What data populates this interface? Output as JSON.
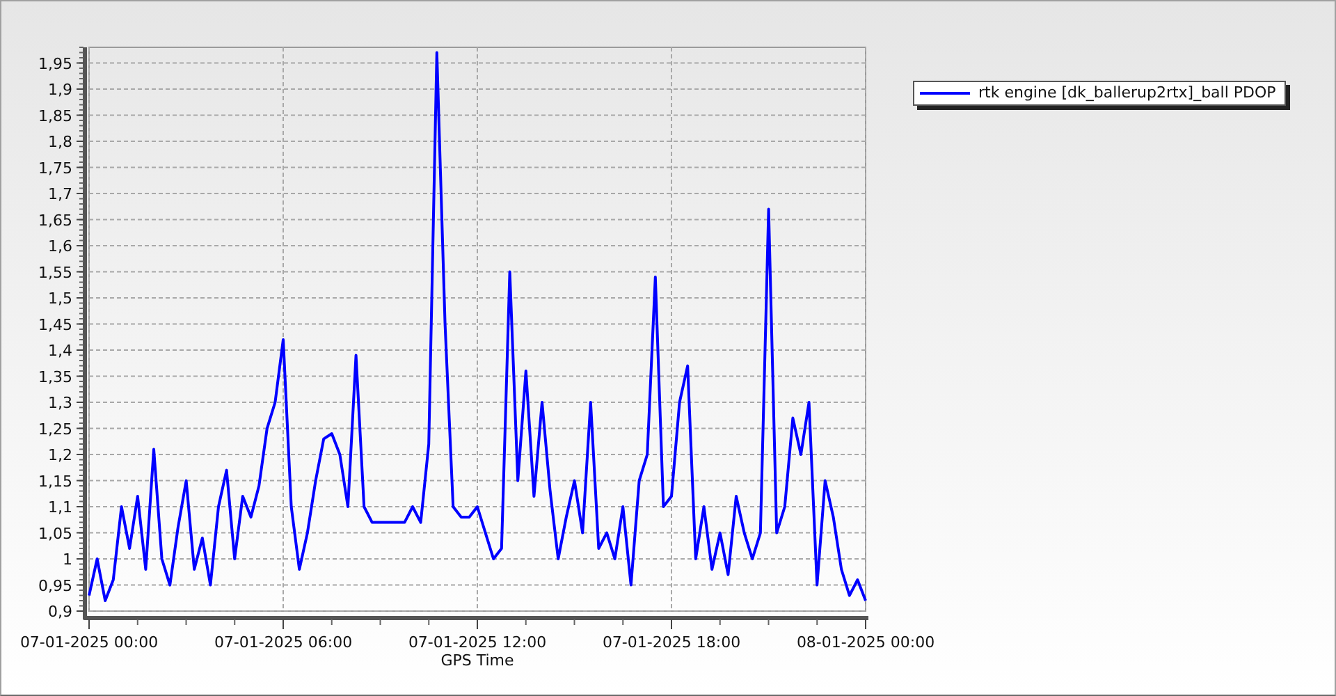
{
  "chart": {
    "chart_data": {
      "type": "line",
      "xlabel": "GPS Time",
      "categories": [
        "07-01-2025 00:00",
        null,
        null,
        null,
        null,
        null,
        null,
        null,
        null,
        null,
        null,
        null,
        null,
        null,
        null,
        null,
        null,
        null,
        null,
        null,
        null,
        null,
        null,
        null,
        "07-01-2025 06:00",
        null,
        null,
        null,
        null,
        null,
        null,
        null,
        null,
        null,
        null,
        null,
        null,
        null,
        null,
        null,
        null,
        null,
        null,
        null,
        null,
        null,
        null,
        null,
        "07-01-2025 12:00",
        null,
        null,
        null,
        null,
        null,
        null,
        null,
        null,
        null,
        null,
        null,
        null,
        null,
        null,
        null,
        null,
        null,
        null,
        null,
        null,
        null,
        null,
        null,
        "07-01-2025 18:00",
        null,
        null,
        null,
        null,
        null,
        null,
        null,
        null,
        null,
        null,
        null,
        null,
        null,
        null,
        null,
        null,
        null,
        null,
        null,
        null,
        null,
        null,
        null,
        "08-01-2025 00:00"
      ],
      "series": [
        {
          "name": "rtk engine [dk_ballerup2rtx]_ball PDOP",
          "color": "#0000ff",
          "values": [
            0.93,
            1.0,
            0.92,
            0.96,
            1.1,
            1.02,
            1.12,
            0.98,
            1.21,
            1.0,
            0.95,
            1.06,
            1.15,
            0.98,
            1.04,
            0.95,
            1.1,
            1.17,
            1.0,
            1.12,
            1.08,
            1.14,
            1.25,
            1.3,
            1.42,
            1.1,
            0.98,
            1.05,
            1.15,
            1.23,
            1.24,
            1.2,
            1.1,
            1.39,
            1.1,
            1.07,
            1.07,
            1.07,
            1.07,
            1.07,
            1.1,
            1.07,
            1.22,
            1.97,
            1.45,
            1.1,
            1.08,
            1.08,
            1.1,
            1.05,
            1.0,
            1.02,
            1.55,
            1.15,
            1.36,
            1.12,
            1.3,
            1.13,
            1.0,
            1.08,
            1.15,
            1.05,
            1.3,
            1.02,
            1.05,
            1.0,
            1.1,
            0.95,
            1.15,
            1.2,
            1.54,
            1.1,
            1.12,
            1.3,
            1.37,
            1.0,
            1.1,
            0.98,
            1.05,
            0.97,
            1.12,
            1.05,
            1.0,
            1.05,
            1.67,
            1.05,
            1.1,
            1.27,
            1.2,
            1.3,
            0.95,
            1.15,
            1.08,
            0.98,
            0.93,
            0.96,
            0.92
          ]
        }
      ],
      "ylim": [
        0.9,
        1.98
      ],
      "grid": true,
      "yticks": [
        {
          "value": 0.9,
          "label": "0,9"
        },
        {
          "value": 0.95,
          "label": "0,95"
        },
        {
          "value": 1,
          "label": "1"
        },
        {
          "value": 1.05,
          "label": "1,05"
        },
        {
          "value": 1.1,
          "label": "1,1"
        },
        {
          "value": 1.15,
          "label": "1,15"
        },
        {
          "value": 1.2,
          "label": "1,2"
        },
        {
          "value": 1.25,
          "label": "1,25"
        },
        {
          "value": 1.3,
          "label": "1,3"
        },
        {
          "value": 1.35,
          "label": "1,35"
        },
        {
          "value": 1.4,
          "label": "1,4"
        },
        {
          "value": 1.45,
          "label": "1,45"
        },
        {
          "value": 1.5,
          "label": "1,5"
        },
        {
          "value": 1.55,
          "label": "1,55"
        },
        {
          "value": 1.6,
          "label": "1,6"
        },
        {
          "value": 1.65,
          "label": "1,65"
        },
        {
          "value": 1.7,
          "label": "1,7"
        },
        {
          "value": 1.75,
          "label": "1,75"
        },
        {
          "value": 1.8,
          "label": "1,8"
        },
        {
          "value": 1.85,
          "label": "1,85"
        },
        {
          "value": 1.9,
          "label": "1,9"
        },
        {
          "value": 1.95,
          "label": "1,95"
        }
      ]
    }
  }
}
